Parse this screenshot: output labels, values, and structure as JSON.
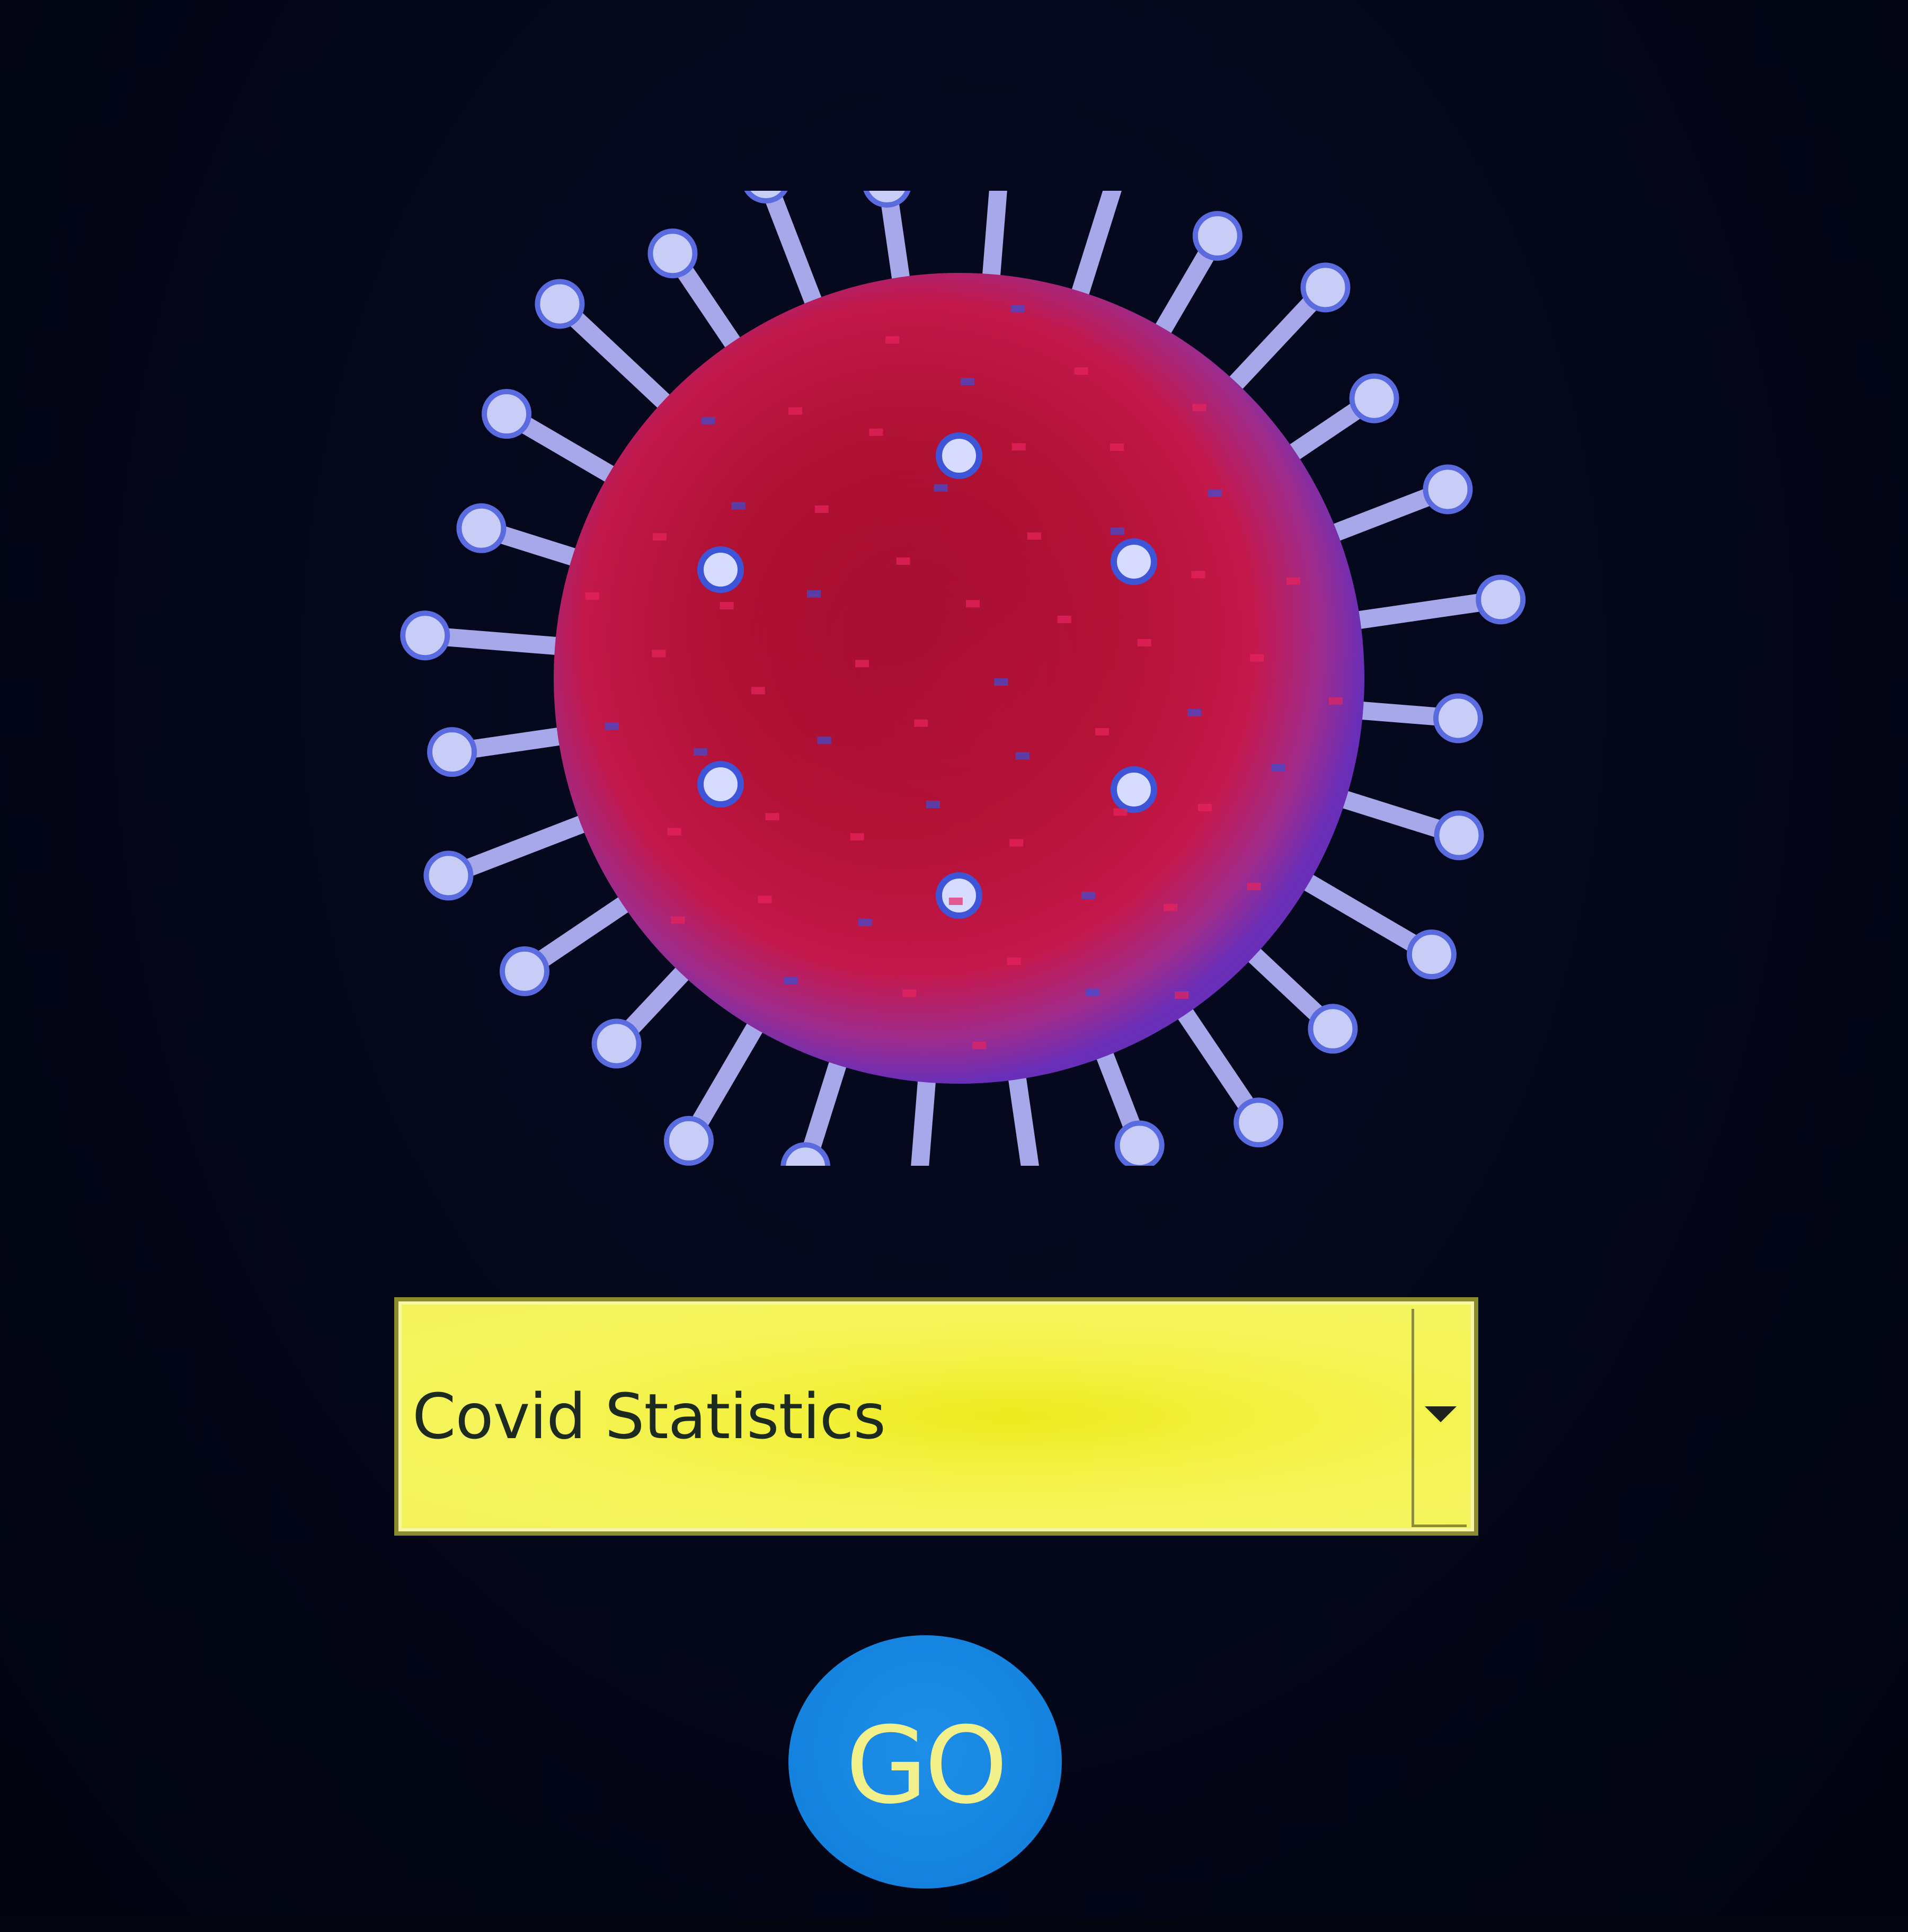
{
  "colors": {
    "background": "#03061a",
    "dropdown_fill": "#f3f140",
    "dropdown_border": "#8a8a2e",
    "dropdown_text": "#1d2a20",
    "go_button_fill": "#1584e0",
    "go_button_text": "#f2f08a",
    "virus_body": "#b0102e",
    "virus_spikes": "#b8b8f0"
  },
  "hero_image": {
    "icon": "coronavirus-icon"
  },
  "dropdown": {
    "selected": "Covid Statistics",
    "caret_icon": "chevron-down-icon"
  },
  "go_button": {
    "label": "GO"
  }
}
